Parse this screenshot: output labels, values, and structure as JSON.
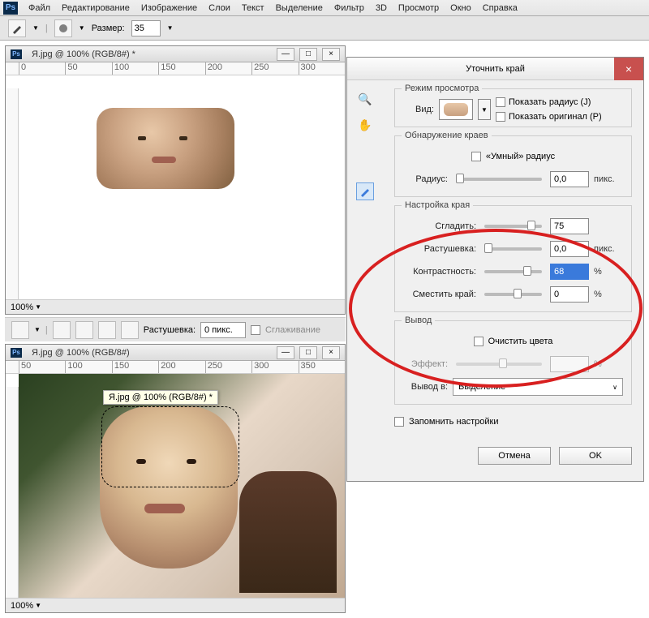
{
  "menubar": [
    "Файл",
    "Редактирование",
    "Изображение",
    "Слои",
    "Текст",
    "Выделение",
    "Фильтр",
    "3D",
    "Просмотр",
    "Окно",
    "Справка"
  ],
  "options": {
    "size_label": "Размер:",
    "size_value": "35"
  },
  "doc1": {
    "title": "Я.jpg @ 100% (RGB/8#) *",
    "ruler_ticks": [
      "0",
      "50",
      "100",
      "150",
      "200",
      "250",
      "300"
    ],
    "zoom": "100%"
  },
  "toolbar2": {
    "feather_label": "Растушевка:",
    "feather_value": "0 пикс.",
    "antialias_label": "Сглаживание"
  },
  "doc2": {
    "title": "Я.jpg @ 100% (RGB/8#)",
    "zoom": "100%",
    "ruler_ticks": [
      "50",
      "100",
      "150",
      "200",
      "250",
      "300",
      "350"
    ],
    "tooltip": "Я.jpg @ 100% (RGB/8#) *"
  },
  "dialog": {
    "title": "Уточнить край",
    "close": "×",
    "view_mode": {
      "group_title": "Режим просмотра",
      "view_label": "Вид:",
      "show_radius": "Показать радиус (J)",
      "show_original": "Показать оригинал (P)"
    },
    "edge_detect": {
      "group_title": "Обнаружение краев",
      "smart_radius": "«Умный» радиус",
      "radius_label": "Радиус:",
      "radius_value": "0,0",
      "radius_unit": "пикс."
    },
    "adjust": {
      "group_title": "Настройка края",
      "smooth_label": "Сгладить:",
      "smooth_value": "75",
      "feather_label": "Растушевка:",
      "feather_value": "0,0",
      "feather_unit": "пикс.",
      "contrast_label": "Контрастность:",
      "contrast_value": "68",
      "contrast_unit": "%",
      "shift_label": "Сместить край:",
      "shift_value": "0",
      "shift_unit": "%"
    },
    "output": {
      "group_title": "Вывод",
      "decontaminate": "Очистить цвета",
      "effect_label": "Эффект:",
      "effect_unit": "%",
      "output_to_label": "Вывод в:",
      "output_to_value": "Выделение"
    },
    "remember": "Запомнить настройки",
    "cancel": "Отмена",
    "ok": "OK"
  }
}
